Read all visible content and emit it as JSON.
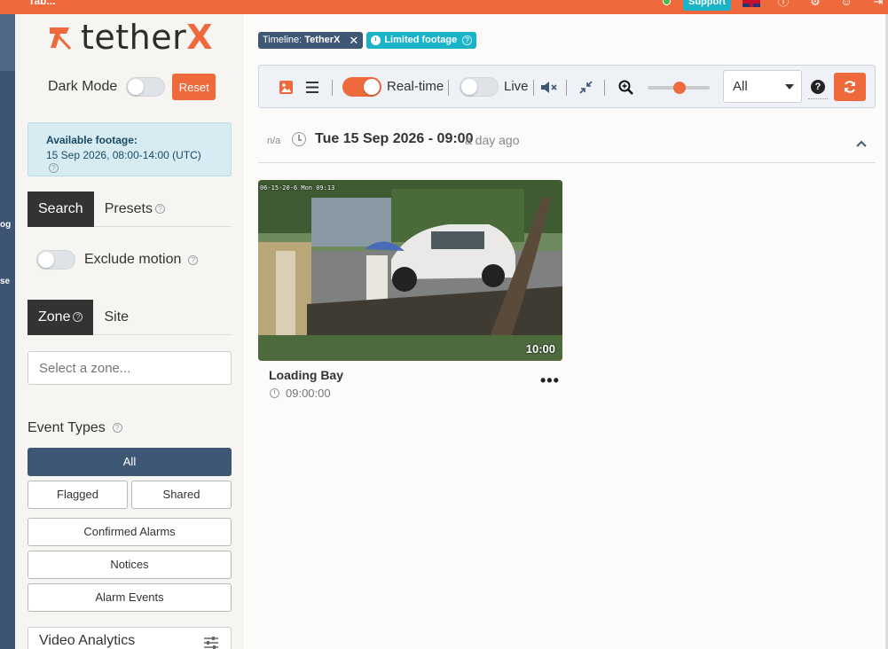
{
  "topbar": {
    "left_fragment": "Tab...",
    "support_label": "Support",
    "icons": [
      "status-dot-icon",
      "uk-flag-icon",
      "info-icon",
      "settings-icon",
      "user-icon",
      "exit-icon"
    ]
  },
  "leftnav": {
    "fragments": [
      "og",
      "se"
    ]
  },
  "sidebar": {
    "logo_text_main": "tether",
    "logo_text_x": "X",
    "dark_mode_label": "Dark Mode",
    "reset_label": "Reset",
    "footage": {
      "title": "Available footage:",
      "range": "15 Sep 2026, 08:00-14:00 (UTC)"
    },
    "search_tabs": [
      {
        "label": "Search",
        "active": true
      },
      {
        "label": "Presets",
        "active": false
      }
    ],
    "exclude_motion_label": "Exclude motion",
    "zone_tabs": [
      {
        "label": "Zone",
        "active": true
      },
      {
        "label": "Site",
        "active": false
      }
    ],
    "zone_placeholder": "Select a zone...",
    "event_types_label": "Event Types",
    "event_buttons": {
      "all": "All",
      "flagged": "Flagged",
      "shared": "Shared",
      "confirmed_alarms": "Confirmed Alarms",
      "notices": "Notices",
      "alarm_events": "Alarm Events"
    },
    "video_analytics_label": "Video Analytics"
  },
  "main": {
    "chips": {
      "timeline_prefix": "Timeline:",
      "timeline_value": "TetherX",
      "limited_footage": "Limited footage"
    },
    "toolbar": {
      "realtime_label": "Real-time",
      "live_label": "Live",
      "filter_value": "All",
      "help_glyph": "?"
    },
    "section": {
      "na": "n/a",
      "datetime": "Tue 15 Sep 2026 - 09:00",
      "ago": "a day ago"
    },
    "card": {
      "overlay_timestamp": "06-15-20-6 Mon 09:13",
      "duration": "10:00",
      "camera_name": "Loading Bay",
      "time": "09:00:00",
      "more": "•••"
    }
  },
  "colors": {
    "accent": "#ee6a3c",
    "nav": "#3d5473",
    "teal": "#1bb3c8"
  }
}
